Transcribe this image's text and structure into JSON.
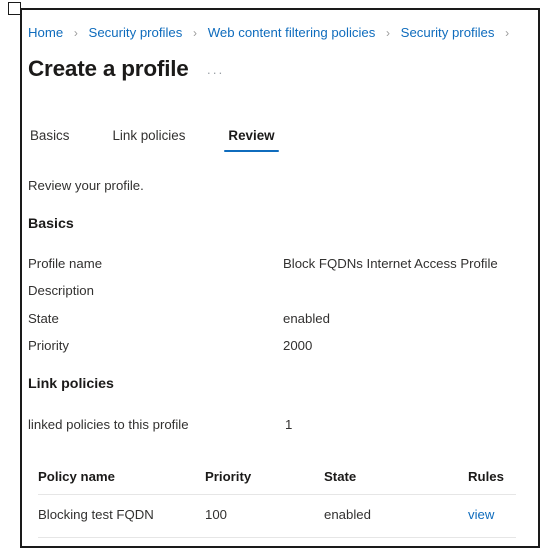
{
  "breadcrumb": {
    "separator": "›",
    "items": [
      {
        "label": "Home"
      },
      {
        "label": "Security profiles"
      },
      {
        "label": "Web content filtering policies"
      },
      {
        "label": "Security profiles"
      }
    ],
    "trailing_separator": "›"
  },
  "header": {
    "title": "Create a profile",
    "more_menu": "···"
  },
  "tabs": [
    {
      "label": "Basics",
      "active": false
    },
    {
      "label": "Link policies",
      "active": false
    },
    {
      "label": "Review",
      "active": true
    }
  ],
  "main": {
    "intro": "Review your profile.",
    "basics": {
      "heading": "Basics",
      "rows": [
        {
          "label": "Profile name",
          "value": "Block FQDNs Internet Access Profile"
        },
        {
          "label": "Description",
          "value": ""
        },
        {
          "label": "State",
          "value": "enabled"
        },
        {
          "label": "Priority",
          "value": "2000"
        }
      ]
    },
    "link_policies": {
      "heading": "Link policies",
      "summary_label": "linked policies to this profile",
      "summary_value": "1",
      "table": {
        "columns": [
          "Policy name",
          "Priority",
          "State",
          "Rules"
        ],
        "rows": [
          {
            "policy_name": "Blocking test FQDN",
            "priority": "100",
            "state": "enabled",
            "rules_link": "view"
          }
        ]
      }
    }
  },
  "colors": {
    "link": "#0f6cbd",
    "accent_underline": "#0f6cbd",
    "text": "#323130",
    "heading": "#1b1a19",
    "border": "#1a1a1a",
    "row_divider": "#e6e6e6"
  }
}
